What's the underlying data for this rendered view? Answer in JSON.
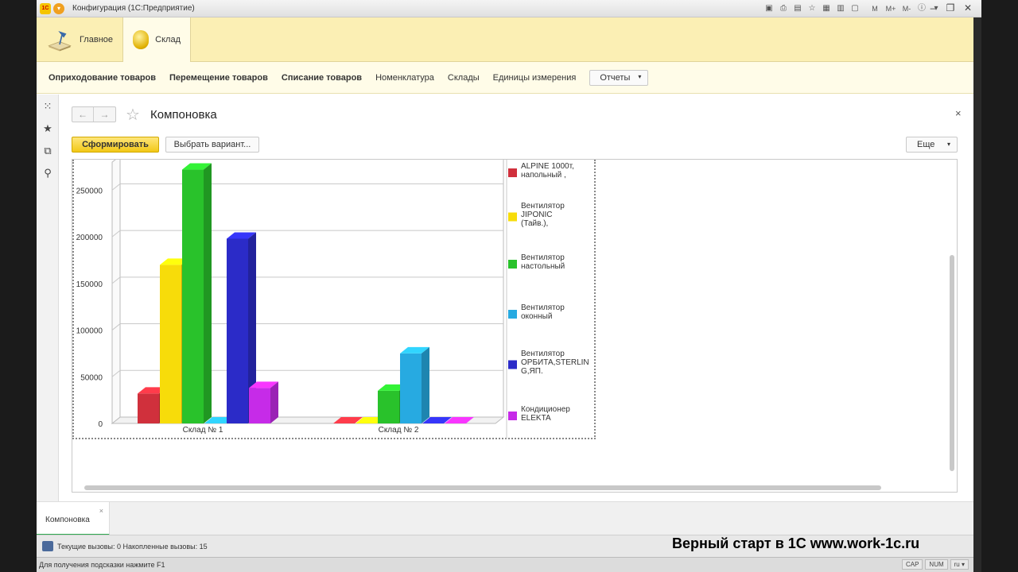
{
  "window": {
    "title": "Конфигурация  (1С:Предприятие)",
    "logo_text": "1С",
    "toolbar_icons": [
      "save-icon",
      "print-icon",
      "preview-icon",
      "star-icon",
      "calc-icon",
      "calendar-icon",
      "doc-icon"
    ],
    "memory_buttons": [
      "M",
      "M+",
      "M-"
    ],
    "controls": {
      "minimize": "–",
      "restore": "❐",
      "close": "✕"
    }
  },
  "sections": [
    {
      "label": "Главное",
      "icon": "desk-lamp-icon"
    },
    {
      "label": "Склад",
      "icon": "coin-icon",
      "active": true
    }
  ],
  "commands": {
    "items": [
      {
        "label": "Оприходование товаров",
        "bold": true
      },
      {
        "label": "Перемещение товаров",
        "bold": true
      },
      {
        "label": "Списание товаров",
        "bold": true
      },
      {
        "label": "Номенклатура",
        "bold": false
      },
      {
        "label": "Склады",
        "bold": false
      },
      {
        "label": "Единицы измерения",
        "bold": false
      }
    ],
    "reports_label": "Отчеты"
  },
  "form": {
    "title": "Компоновка",
    "back": "←",
    "forward": "→",
    "close": "×",
    "generate_label": "Сформировать",
    "variant_label": "Выбрать вариант...",
    "more_label": "Еще"
  },
  "chart_data": {
    "type": "bar",
    "title": "",
    "xlabel": "",
    "ylabel": "",
    "ylim": [
      0,
      280000
    ],
    "yticks": [
      0,
      50000,
      100000,
      150000,
      200000,
      250000
    ],
    "categories": [
      "Склад № 1",
      "Склад № 2"
    ],
    "series": [
      {
        "name": "ALPINE 1000т, напольный ,",
        "color": "#d0303c",
        "values": [
          32000,
          0
        ]
      },
      {
        "name": "Вентилятор JIPONIC (Тайв.),",
        "color": "#f7dc0a",
        "values": [
          170000,
          0
        ]
      },
      {
        "name": "Вентилятор настольный",
        "color": "#29c22b",
        "values": [
          272000,
          35000
        ]
      },
      {
        "name": "Вентилятор оконный",
        "color": "#27aae1",
        "values": [
          0,
          75000
        ]
      },
      {
        "name": "Вентилятор ОРБИТА,STERLIN G,ЯП.",
        "color": "#2b2bc8",
        "values": [
          198000,
          0
        ]
      },
      {
        "name": "Кондиционер ELEKTA",
        "color": "#c62be8",
        "values": [
          38000,
          0
        ]
      }
    ],
    "legend": "right",
    "grid": true
  },
  "open_windows": [
    {
      "label": "Компоновка",
      "close": "×"
    }
  ],
  "status": {
    "calls": "Текущие вызовы: 0   Накопленные вызовы: 15",
    "watermark": "Верный старт в 1С www.work-1c.ru",
    "hint": "Для получения подсказки нажмите F1",
    "indicators": [
      "CAP",
      "NUM",
      "ru ▾"
    ]
  }
}
